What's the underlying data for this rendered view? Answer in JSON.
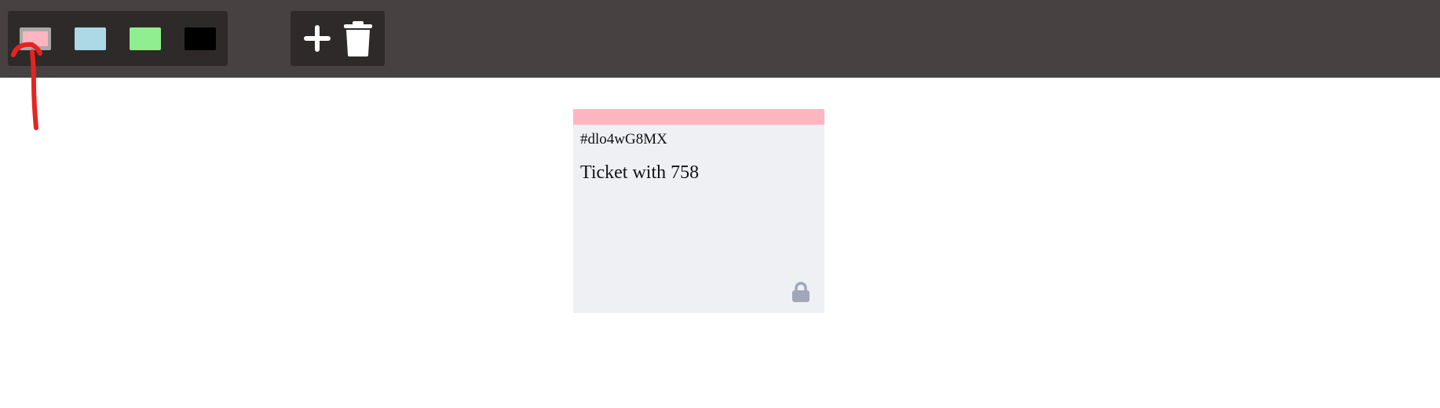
{
  "toolbar": {
    "color_swatches": [
      {
        "name": "pink",
        "color": "#ffb6c1",
        "selected": true
      },
      {
        "name": "light-blue",
        "color": "#add8e6",
        "selected": false
      },
      {
        "name": "light-green",
        "color": "#90ee90",
        "selected": false
      },
      {
        "name": "black",
        "color": "#000000",
        "selected": false
      }
    ],
    "actions": {
      "add_icon": "plus-icon",
      "delete_icon": "trash-icon"
    }
  },
  "ticket": {
    "id": "#dlo4wG8MX",
    "text": "Ticket with 758",
    "color": "#ffb6c1",
    "lock_icon": "lock-icon"
  },
  "annotation": {
    "color": "#e8231f"
  }
}
